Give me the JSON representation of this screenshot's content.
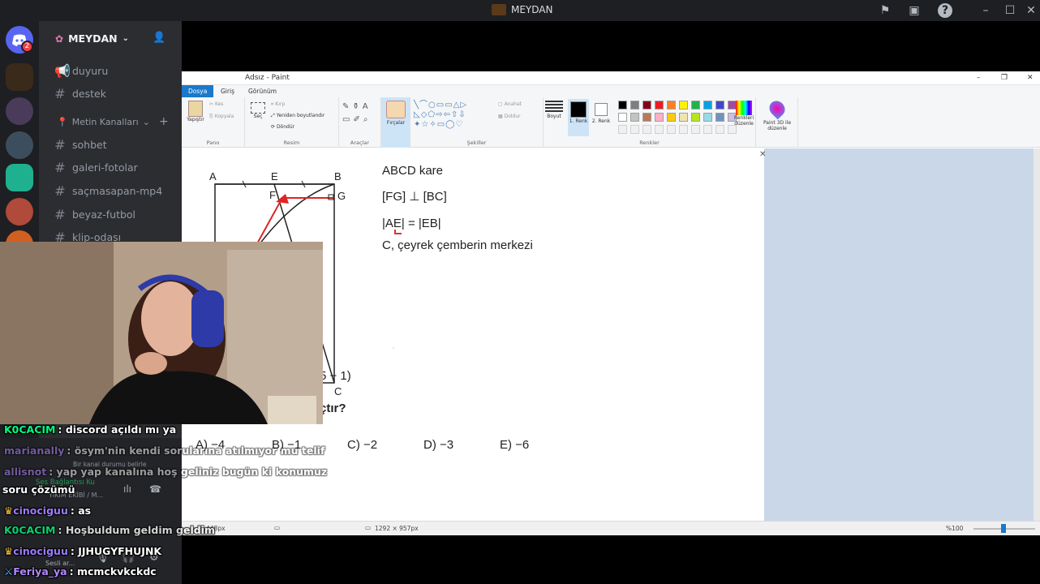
{
  "window": {
    "title": "MEYDAN"
  },
  "server": {
    "name": "MEYDAN"
  },
  "channels": {
    "top": [
      {
        "name": "duyuru",
        "type": "announcement"
      },
      {
        "name": "destek",
        "type": "text"
      }
    ],
    "category": "Metin Kanalları",
    "list": [
      "sohbet",
      "galeri-fotolar",
      "saçmasapan-mp4",
      "beyaz-futbol",
      "klip-odası"
    ]
  },
  "guild_badge": "2",
  "paint": {
    "title": "Adsız - Paint",
    "tabs": [
      "Dosya",
      "Giriş",
      "Görünüm"
    ],
    "groups": {
      "pano": "Pano",
      "resim": "Resim",
      "araclar": "Araçlar",
      "sekiller": "Şekiller",
      "renkler": "Renkler"
    },
    "buttons": {
      "yapistir": "Yapıştır",
      "kes": "Kes",
      "kopyala": "Kopyala",
      "sec": "Seç",
      "kirp": "Kırp",
      "yeniden_boyutlandir": "Yeniden boyutlandır",
      "dondur": "Döndür",
      "fircalar": "Fırçalar",
      "anahat": "Anahat",
      "doldur": "Doldur",
      "boyut": "Boyut",
      "renk1": "1. Renk",
      "renk2": "2. Renk",
      "renkleri_duzenle": "Renkleri düzenle",
      "paint3d": "Paint 3D ile düzenle"
    },
    "palette": [
      "#000000",
      "#7f7f7f",
      "#880015",
      "#ed1c24",
      "#ff7f27",
      "#fff200",
      "#22b14c",
      "#00a2e8",
      "#3f48cc",
      "#a349a4",
      "#ffffff",
      "#c3c3c3",
      "#b97a57",
      "#ffaec9",
      "#ffc90e",
      "#efe4b0",
      "#b5e61d",
      "#99d9ea",
      "#7092be",
      "#c8bfe7"
    ],
    "status": {
      "position": "448px",
      "size": "1292 × 957px",
      "zoom": "%100"
    }
  },
  "problem": {
    "given": [
      "ABCD kare",
      "[FG] ⊥ [BC]",
      "|AE| = |EB|",
      "C, çeyrek çemberin merkezi"
    ],
    "points": [
      "A",
      "E",
      "B",
      "F",
      "G",
      "C"
    ],
    "expression_fragment": "5 − 1)",
    "question_fragment": "çtır?",
    "options": [
      "A) −4",
      "B) −1",
      "C) −2",
      "D) −3",
      "E) −6"
    ]
  },
  "chat": [
    {
      "user": "K0CACIM",
      "text": ": discord açıldı mı ya",
      "color": "#00ff7f"
    },
    {
      "user": "marianally",
      "text": ": ösym'nin kendi sorularına atılmıyor mu telif",
      "color": "#b388ff"
    },
    {
      "user": "allisnot",
      "text": ": yap yap kanalına hoş geliniz bugün ki konumuz",
      "color": "#b388ff"
    },
    {
      "user": "",
      "text": "soru çözümü",
      "color": "#ffffff"
    },
    {
      "user": "cinociguu",
      "text": ": as",
      "color": "#9c7cff"
    },
    {
      "user": "K0CACIM",
      "text": ": Hoşbuldum geldim geldim",
      "color": "#00ff7f"
    },
    {
      "user": "cinociguu",
      "text": ": JJHUGYFHUJNK",
      "color": "#9c7cff"
    },
    {
      "user": "Feriya_ya",
      "text": ": mcmckvkckdc",
      "color": "#b388ff"
    }
  ],
  "voice_ghost": {
    "label": "Ses Bağlantısı Ku",
    "sub": "YIKIM EKİBİ / M...",
    "status": "Bir kanal durumu belirle",
    "ses": "Sesli ar..."
  }
}
